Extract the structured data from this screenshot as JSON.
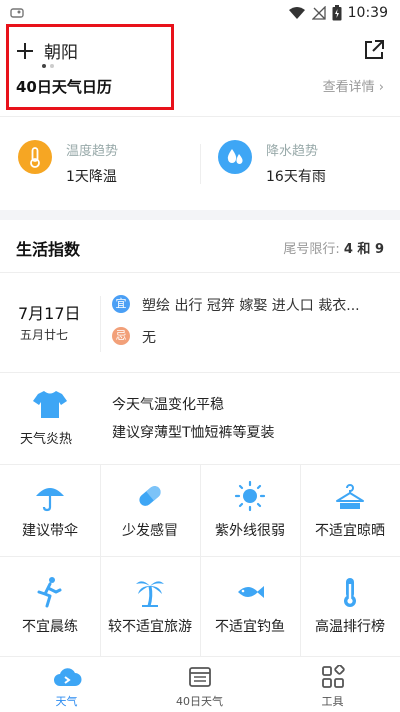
{
  "status_bar": {
    "time": "10:39"
  },
  "header": {
    "city": "朝阳",
    "calendar_title": "40日天气日历",
    "view_details": "查看详情 ›"
  },
  "trends": {
    "temperature": {
      "title": "温度趋势",
      "value": "1天降温",
      "color": "#f6a623"
    },
    "precipitation": {
      "title": "降水趋势",
      "value": "16天有雨",
      "color": "#3ea6f5"
    }
  },
  "life_index": {
    "title": "生活指数",
    "plate_label": "尾号限行: ",
    "plate_values": "4 和 9"
  },
  "almanac": {
    "date": "7月17日",
    "lunar": "五月廿七",
    "yi_badge": "宜",
    "yi_text": "塑绘 出行 冠笄 嫁娶 进人口 裁衣...",
    "ji_badge": "忌",
    "ji_text": "无",
    "yi_color": "#4a9ff5",
    "ji_color": "#f2a079"
  },
  "weather_note": {
    "label": "天气炎热",
    "line1": "今天气温变化平稳",
    "line2": "建议穿薄型T恤短裤等夏装"
  },
  "indices": [
    {
      "label": "建议带伞",
      "icon": "umbrella-icon"
    },
    {
      "label": "少发感冒",
      "icon": "pill-icon"
    },
    {
      "label": "紫外线很弱",
      "icon": "sun-icon"
    },
    {
      "label": "不适宜晾晒",
      "icon": "hanger-icon"
    },
    {
      "label": "不宜晨练",
      "icon": "runner-icon"
    },
    {
      "label": "较不适宜旅游",
      "icon": "palm-tree-icon"
    },
    {
      "label": "不适宜钓鱼",
      "icon": "fish-icon"
    },
    {
      "label": "高温排行榜",
      "icon": "thermometer-icon"
    }
  ],
  "bottom_nav": [
    {
      "label": "天气",
      "icon": "cloud-icon",
      "active": true
    },
    {
      "label": "40日天气",
      "icon": "calendar-icon",
      "active": false
    },
    {
      "label": "工具",
      "icon": "tools-icon",
      "active": false
    }
  ],
  "colors": {
    "accent": "#2d8cf0",
    "highlight": "#e8111a",
    "icon_blue": "#3ea6f5"
  }
}
